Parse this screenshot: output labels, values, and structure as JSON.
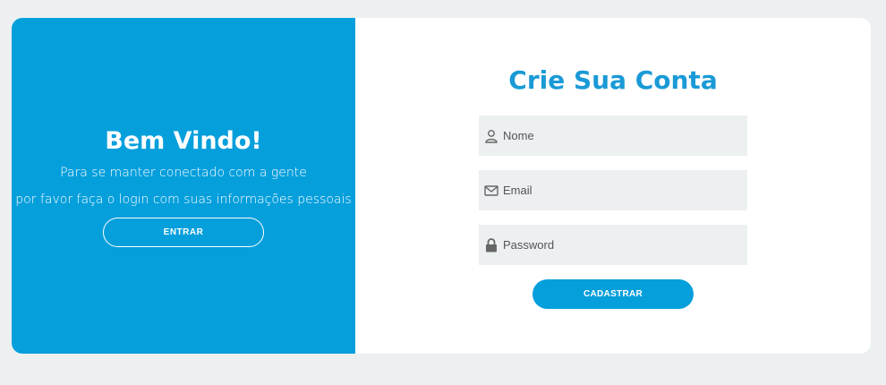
{
  "welcome": {
    "title": "Bem Vindo!",
    "line1": "Para se manter conectado com a gente",
    "line2": "por favor faça o login com suas informações pessoais",
    "button_label": "ENTRAR"
  },
  "signup": {
    "title": "Crie Sua Conta",
    "fields": {
      "name": {
        "placeholder": "Nome",
        "value": "",
        "icon": "user-icon"
      },
      "email": {
        "placeholder": "Email",
        "value": "",
        "icon": "envelope-icon"
      },
      "password": {
        "placeholder": "Password",
        "value": "",
        "icon": "lock-icon"
      }
    },
    "button_label": "CADASTRAR"
  },
  "colors": {
    "primary": "#059fdc",
    "title_blue": "#1a9ad6",
    "field_bg": "#ecf0f1",
    "page_bg": "#ecf0f1"
  }
}
